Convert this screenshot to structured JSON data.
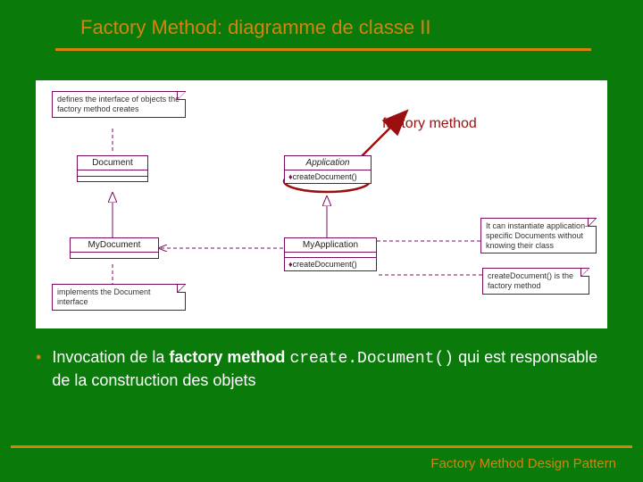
{
  "title": "Factory Method: diagramme de classe II",
  "annotation": {
    "factory_method": "factory method"
  },
  "notes": {
    "product_def": "defines the interface of objects the factory method creates",
    "concrete_product": "implements the Document interface",
    "creator_role": "It can instantiate application-specific Documents without knowing their class",
    "concrete_creator_role": "createDocument() is the factory method"
  },
  "uml": {
    "document": {
      "name": "Document"
    },
    "my_document": {
      "name": "MyDocument"
    },
    "application": {
      "name": "Application",
      "op1": "createDocument()"
    },
    "my_application": {
      "name": "MyApplication",
      "op1": "createDocument()"
    }
  },
  "bullet": {
    "pre": "Invocation de la ",
    "bold": "factory method ",
    "code": "create.Document()",
    "post": " qui est responsable de la construction des objets"
  },
  "footer": "Factory Method Design Pattern"
}
